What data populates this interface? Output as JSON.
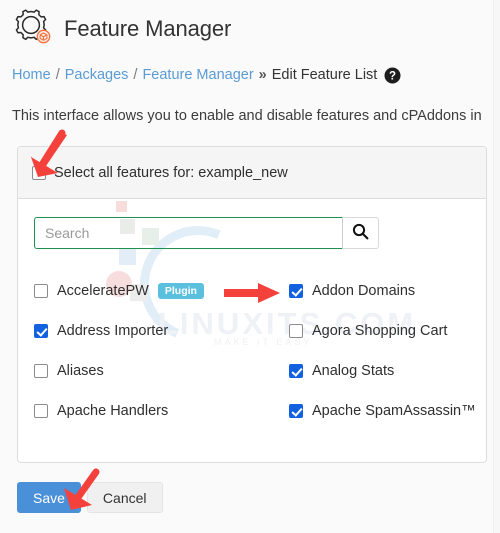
{
  "header": {
    "title": "Feature Manager",
    "icon": "gear-cube-icon"
  },
  "breadcrumb": {
    "items": [
      {
        "label": "Home",
        "link": true
      },
      {
        "label": "Packages",
        "link": true
      },
      {
        "label": "Feature Manager",
        "link": true
      },
      {
        "label": "Edit Feature List",
        "link": false
      }
    ],
    "separator": "/",
    "final_separator": "»",
    "help_icon": "question-circle-icon"
  },
  "description": "This interface allows you to enable and disable features and cPAddons in",
  "panel": {
    "select_all": {
      "label": "Select all features for: example_new",
      "checked": false
    },
    "search": {
      "placeholder": "Search",
      "value": "",
      "button_icon": "search-icon",
      "border_color": "#1e9150"
    },
    "features": [
      {
        "label": "AcceleratePW",
        "checked": false,
        "badge": "Plugin"
      },
      {
        "label": "Addon Domains",
        "checked": true,
        "badge": null
      },
      {
        "label": "Address Importer",
        "checked": true,
        "badge": null
      },
      {
        "label": "Agora Shopping Cart",
        "checked": false,
        "badge": null
      },
      {
        "label": "Aliases",
        "checked": false,
        "badge": null
      },
      {
        "label": "Analog Stats",
        "checked": true,
        "badge": null
      },
      {
        "label": "Apache Handlers",
        "checked": false,
        "badge": null
      },
      {
        "label": "Apache SpamAssassin™",
        "checked": true,
        "badge": null
      }
    ]
  },
  "footer": {
    "save_label": "Save",
    "cancel_label": "Cancel"
  },
  "watermark": {
    "text": "LINUXITS.COM",
    "subtitle": "MAKE IT EASY"
  },
  "annotations": {
    "arrow_color": "#f4413c",
    "arrows": [
      {
        "name": "arrow-to-select-all",
        "target": "select-all-checkbox"
      },
      {
        "name": "arrow-to-addon-domains",
        "target": "addon-domains-checkbox"
      },
      {
        "name": "arrow-to-save",
        "target": "save-button"
      }
    ]
  },
  "colors": {
    "accent_blue": "#4a90d9",
    "checkbox_blue": "#1161e0",
    "link_blue": "#5b9bd5",
    "badge_blue": "#5bc0de",
    "search_green": "#1e9150",
    "arrow_red": "#f4413c",
    "icon_orange": "#f2703a"
  }
}
